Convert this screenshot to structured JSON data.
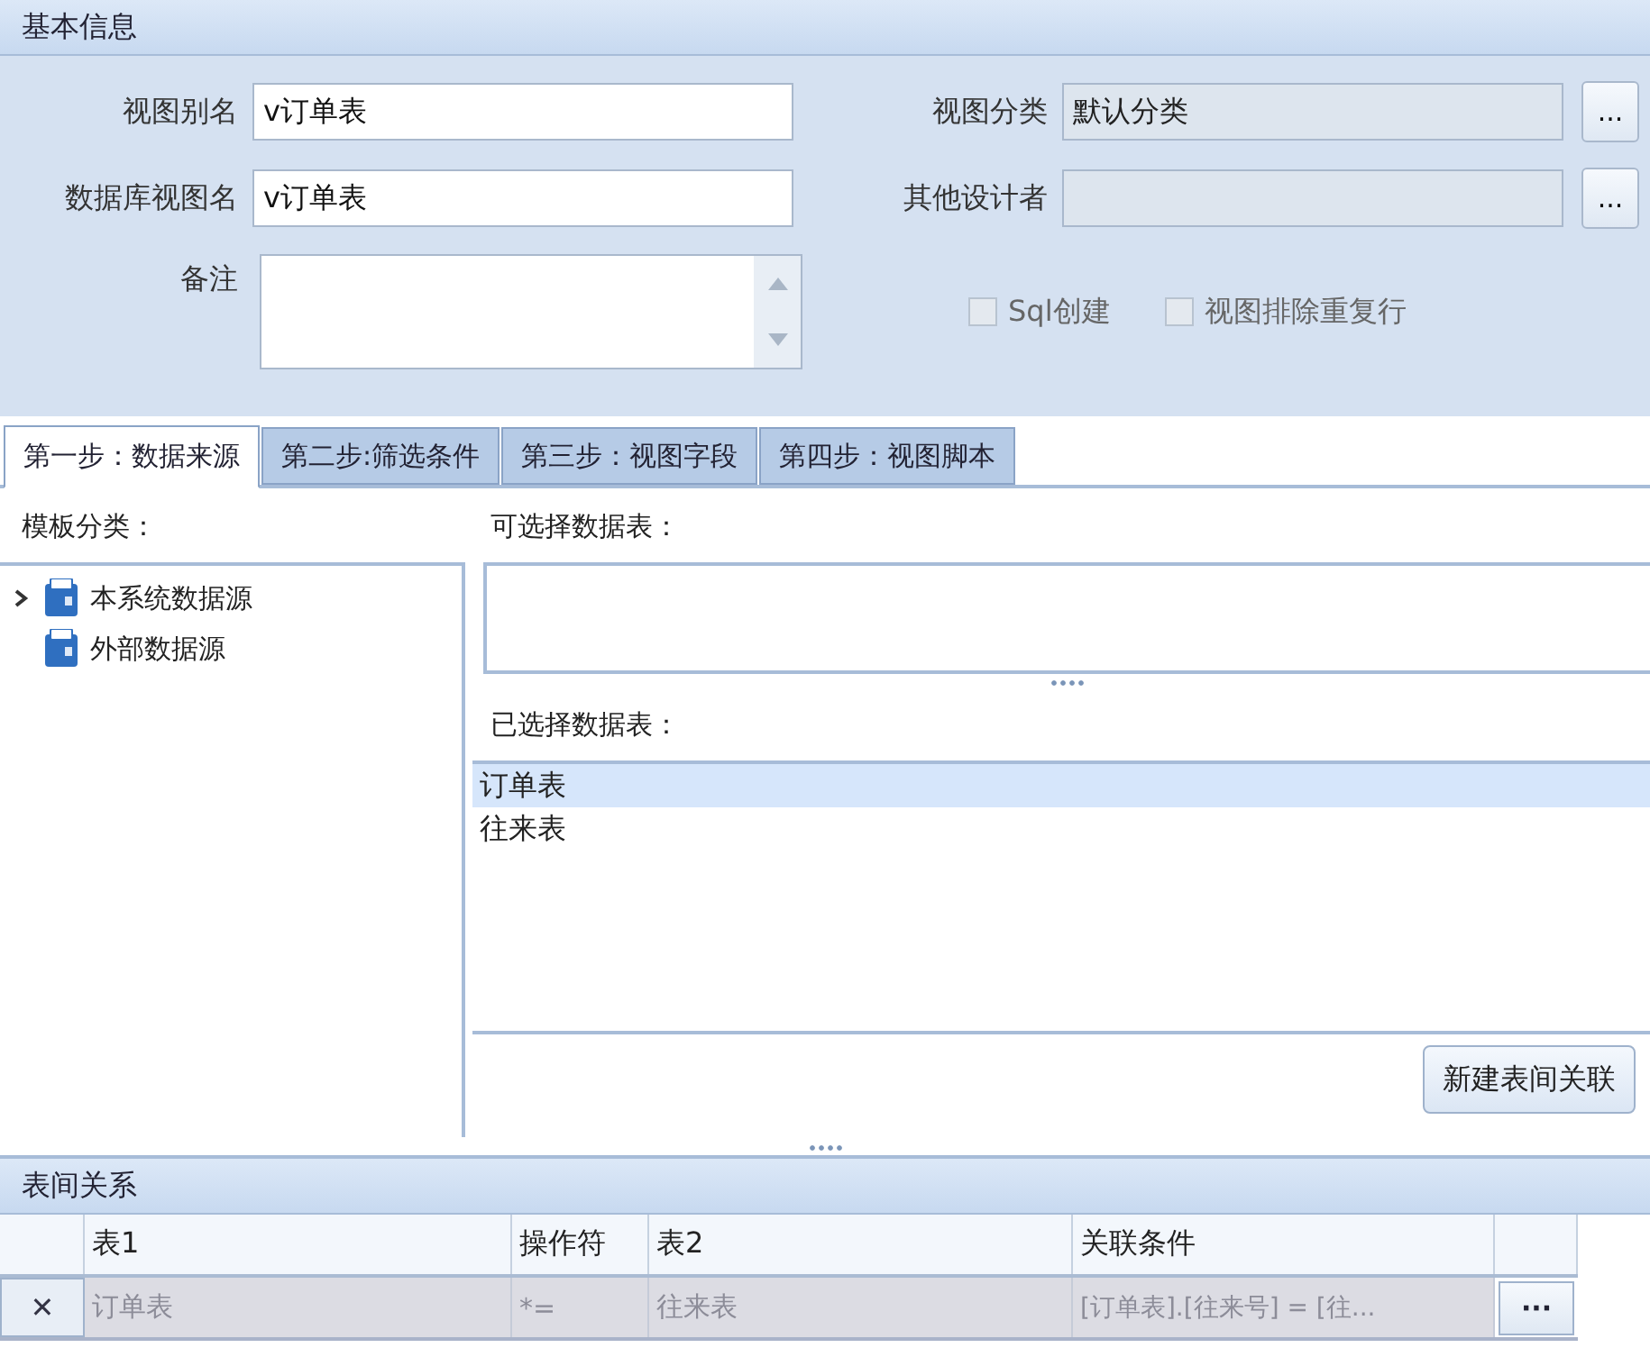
{
  "basic_info": {
    "title": "基本信息",
    "fields": [
      {
        "label": "视图别名",
        "value": "v订单表",
        "disabled": false
      },
      {
        "label": "视图分类",
        "value": "默认分类",
        "disabled": true,
        "browse": "..."
      },
      {
        "label": "数据库视图名",
        "value": "v订单表",
        "disabled": false
      },
      {
        "label": "其他设计者",
        "disabled": true,
        "browse": "..."
      }
    ],
    "remark": {
      "label": "备注"
    },
    "checkboxes": [
      {
        "label": "Sql创建",
        "checked": false,
        "disabled": true
      },
      {
        "label": "视图排除重复行",
        "checked": false,
        "disabled": true
      }
    ]
  },
  "tabs": [
    {
      "label": "第一步：数据来源",
      "selected": true
    },
    {
      "label": "第二步:筛选条件",
      "selected": false
    },
    {
      "label": "第三步：视图字段",
      "selected": false
    },
    {
      "label": "第四步：视图脚本",
      "selected": false
    }
  ],
  "template": {
    "title": "模板分类：",
    "tree": [
      {
        "label": "本系统数据源",
        "expandable": true,
        "expanded": false
      },
      {
        "label": "外部数据源",
        "expandable": false
      }
    ]
  },
  "available_tables": {
    "title": "可选择数据表："
  },
  "selected_tables": {
    "title": "已选择数据表：",
    "items": [
      {
        "label": "订单表",
        "selected": true
      },
      {
        "label": "往来表",
        "selected": false
      }
    ]
  },
  "new_relation_button": "新建表间关联",
  "relations": {
    "title": "表间关系",
    "columns": [
      "表1",
      "操作符",
      "表2",
      "关联条件"
    ],
    "rows": [
      {
        "delete": "✕",
        "cells": [
          "订单表",
          "*=",
          "往来表",
          "[订单表].[往来号] = [往..."
        ],
        "browse": "···"
      }
    ]
  }
}
